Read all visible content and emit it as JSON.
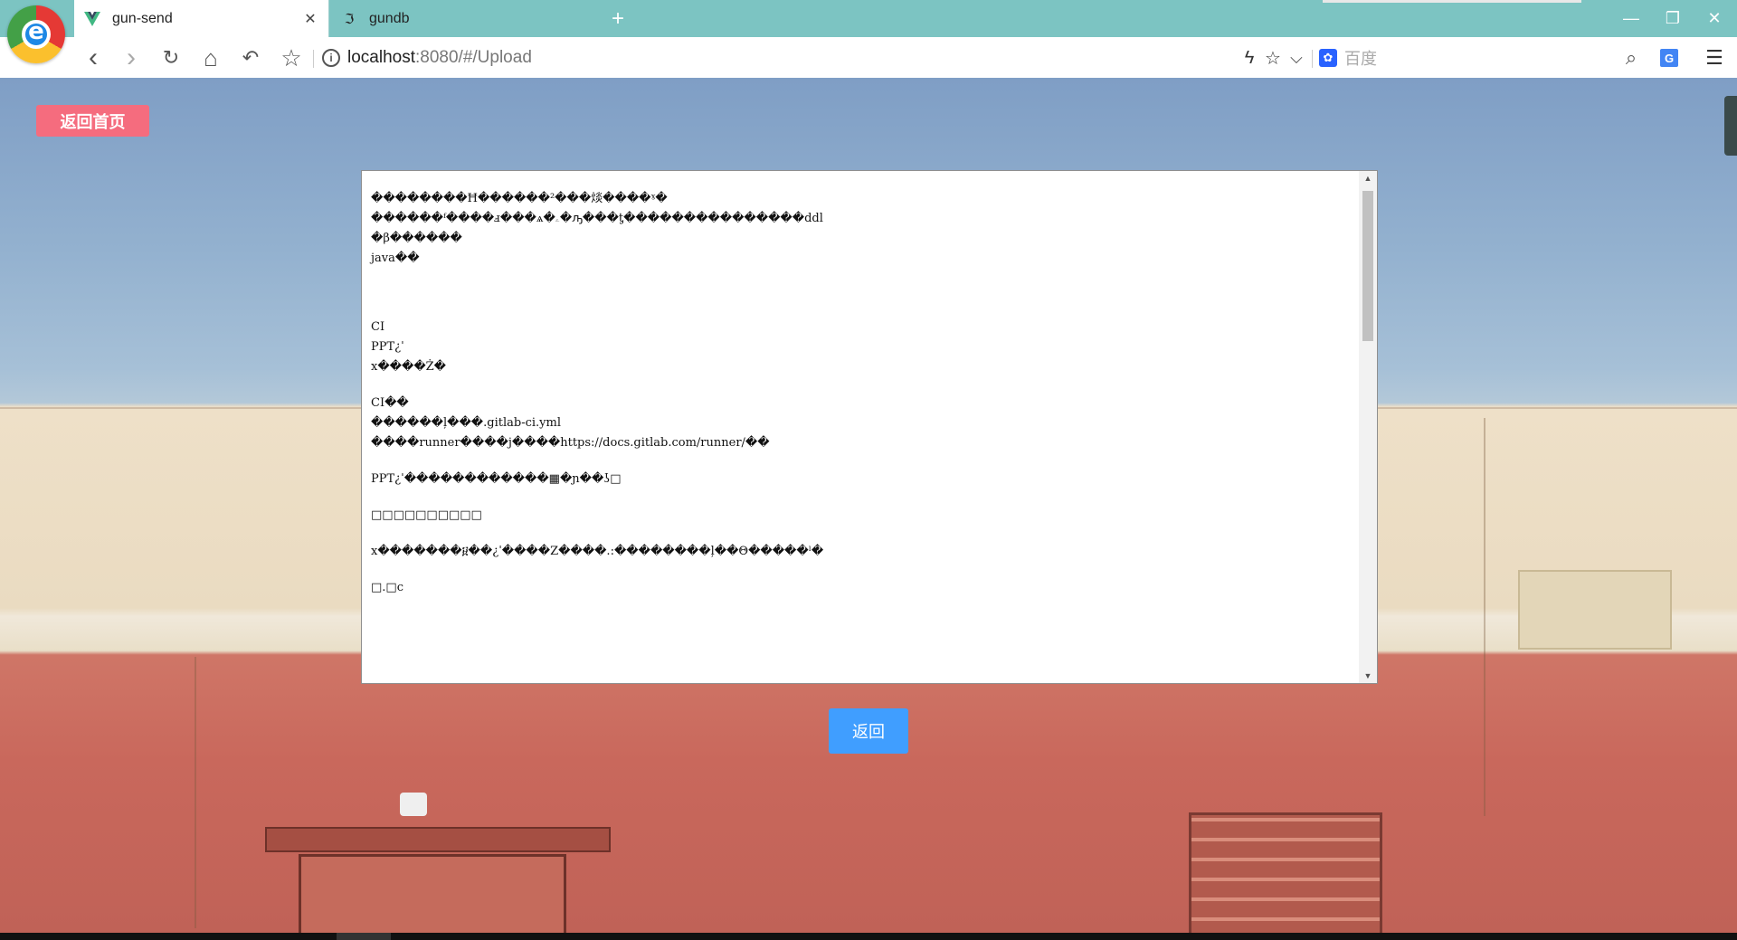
{
  "browser": {
    "tabs": [
      {
        "label": "gun-send",
        "active": true,
        "icon": "vue-logo-icon"
      },
      {
        "label": "gundb",
        "active": false,
        "icon": "gundb-icon"
      }
    ],
    "new_tab_label": "+",
    "window_controls": {
      "minimize": "—",
      "restore": "❐",
      "close": "✕"
    },
    "nav": {
      "back": "‹",
      "forward": "›",
      "reload": "↻",
      "home": "⌂",
      "undo": "↶",
      "bookmark": "☆"
    },
    "url": {
      "host": "localhost",
      "path": ":8080/#/Upload"
    },
    "url_actions": {
      "flash": "ϟ",
      "star": "☆",
      "dropdown": "⌵"
    },
    "search": {
      "engine_icon": "baidu-paw-icon",
      "placeholder": "百度"
    },
    "right_icons": {
      "search": "⌕",
      "translate": "G",
      "menu": "☰"
    },
    "accent": "#7cc4c2"
  },
  "page": {
    "home_button": "返回首页",
    "back_button": "返回",
    "home_button_color": "#f56c7e",
    "back_button_color": "#409eff",
    "document_lines": [
      "��������Ħ������²���㷋����ˠ�",
      "������ᶠ����ⅎ���ѧ�ۦ�ԡ���ƫ���������������ddl",
      "�β������",
      "java��",
      "",
      "",
      "",
      "CI",
      "PPT¿ˈ",
      "x����Ż�",
      "",
      "CI��",
      "������ļ���.gitlab-ci.yml",
      "����runner����j����https://docs.gitlab.com/runner/��",
      "",
      "PPT¿ˈ������������▦�ɲ��ʖ□",
      "",
      "□□□□□□□□□□",
      "",
      "x�������፱��¿ˈ����Z����.:��������ļ��Θ�����ˡ�",
      "",
      "□.□c"
    ]
  }
}
